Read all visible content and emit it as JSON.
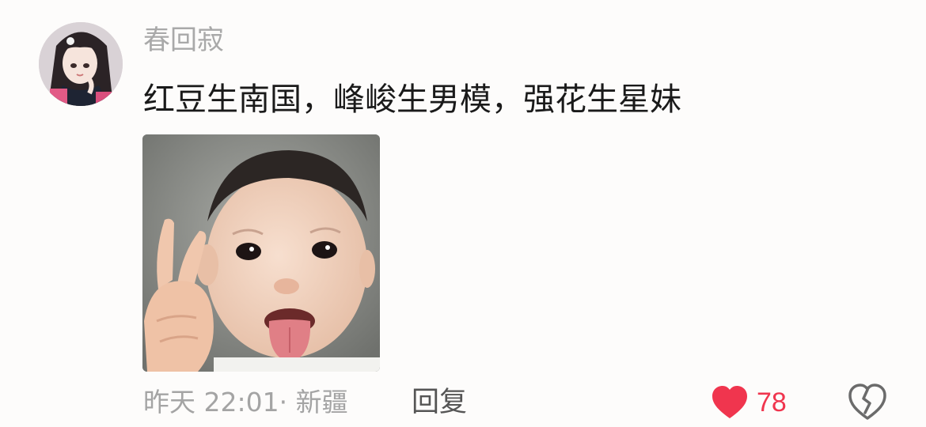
{
  "comment": {
    "username": "春回寂",
    "text": "红豆生南国，峰峻生男模，强花生星妹",
    "avatar_icon": "anime-girl-avatar",
    "image_icon": "child-peace-sign-photo",
    "time": "昨天 22:01",
    "separator": "·",
    "location": "新疆",
    "reply_label": "回复",
    "like_count": "78",
    "like_color": "#f0354e",
    "dislike_icon": "broken-heart-icon"
  }
}
